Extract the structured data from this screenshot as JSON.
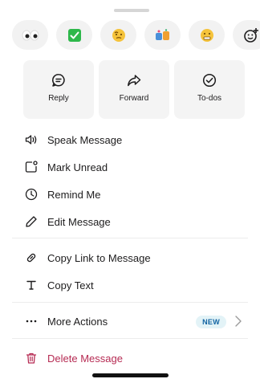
{
  "reactions": [
    {
      "icon": "eyes-emoji-icon"
    },
    {
      "icon": "check-mark-emoji-icon"
    },
    {
      "icon": "raised-eyebrow-emoji-icon"
    },
    {
      "icon": "tada-emoji-icon"
    },
    {
      "icon": "grimace-emoji-icon"
    },
    {
      "icon": "add-reaction-icon"
    }
  ],
  "quick_actions": [
    {
      "label": "Reply",
      "icon": "reply-bubble-icon"
    },
    {
      "label": "Forward",
      "icon": "forward-arrow-icon"
    },
    {
      "label": "To-dos",
      "icon": "check-circle-icon"
    }
  ],
  "menu": {
    "speak": "Speak Message",
    "mark_unread": "Mark Unread",
    "remind": "Remind Me",
    "edit": "Edit Message",
    "copy_link": "Copy Link to Message",
    "copy_text": "Copy Text",
    "more": "More Actions",
    "more_badge": "NEW",
    "delete": "Delete Message"
  },
  "colors": {
    "danger": "#b62b53",
    "badge_bg": "#e3f3f7",
    "badge_text": "#1264a3"
  }
}
